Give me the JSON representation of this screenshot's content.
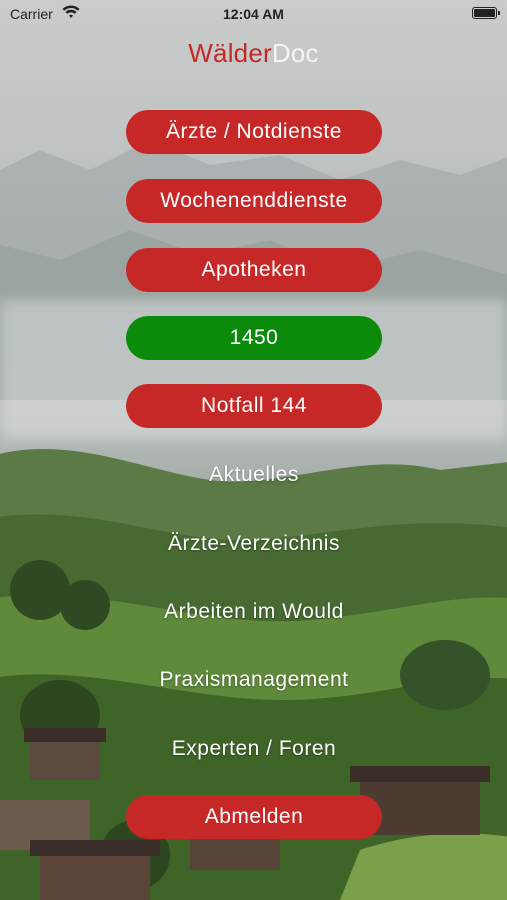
{
  "status_bar": {
    "carrier": "Carrier",
    "time": "12:04 AM",
    "wifi_icon": "wifi-icon",
    "battery_icon": "battery-full-icon"
  },
  "logo": {
    "part1": "Wälder",
    "part2": "Doc",
    "part1_color": "#c62828",
    "part2_color": "#f4f4f4"
  },
  "menu": {
    "items": [
      {
        "label": "Ärzte / Notdienste",
        "style": "red"
      },
      {
        "label": "Wochenenddienste",
        "style": "red"
      },
      {
        "label": "Apotheken",
        "style": "red"
      },
      {
        "label": "1450",
        "style": "green"
      },
      {
        "label": "Notfall 144",
        "style": "red"
      },
      {
        "label": "Aktuelles",
        "style": "plain"
      },
      {
        "label": "Ärzte-Verzeichnis",
        "style": "plain"
      },
      {
        "label": "Arbeiten im Would",
        "style": "plain"
      },
      {
        "label": "Praxismanagement",
        "style": "plain"
      },
      {
        "label": "Experten / Foren",
        "style": "plain"
      },
      {
        "label": "Abmelden",
        "style": "red"
      }
    ]
  },
  "colors": {
    "accent_red": "#c62828",
    "accent_green": "#0b8a0b"
  }
}
